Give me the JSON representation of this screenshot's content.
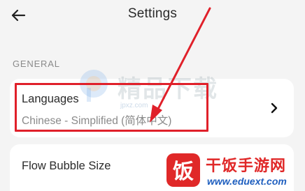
{
  "header": {
    "title": "Settings"
  },
  "sections": {
    "general_label": "GENERAL"
  },
  "languages": {
    "title": "Languages",
    "value": "Chinese - Simplified (简体中文)"
  },
  "flow_bubble": {
    "title": "Flow Bubble Size"
  },
  "watermarks": {
    "center_text": "精品下载",
    "center_url": "jpxz.com",
    "corner_text": "干饭手游网",
    "corner_url": "www.eduext.com",
    "corner_logo": "饭"
  },
  "colors": {
    "annotation_red": "#e0202a",
    "corner_brand_red": "#e02828",
    "corner_url_blue": "#1f5fbf"
  }
}
